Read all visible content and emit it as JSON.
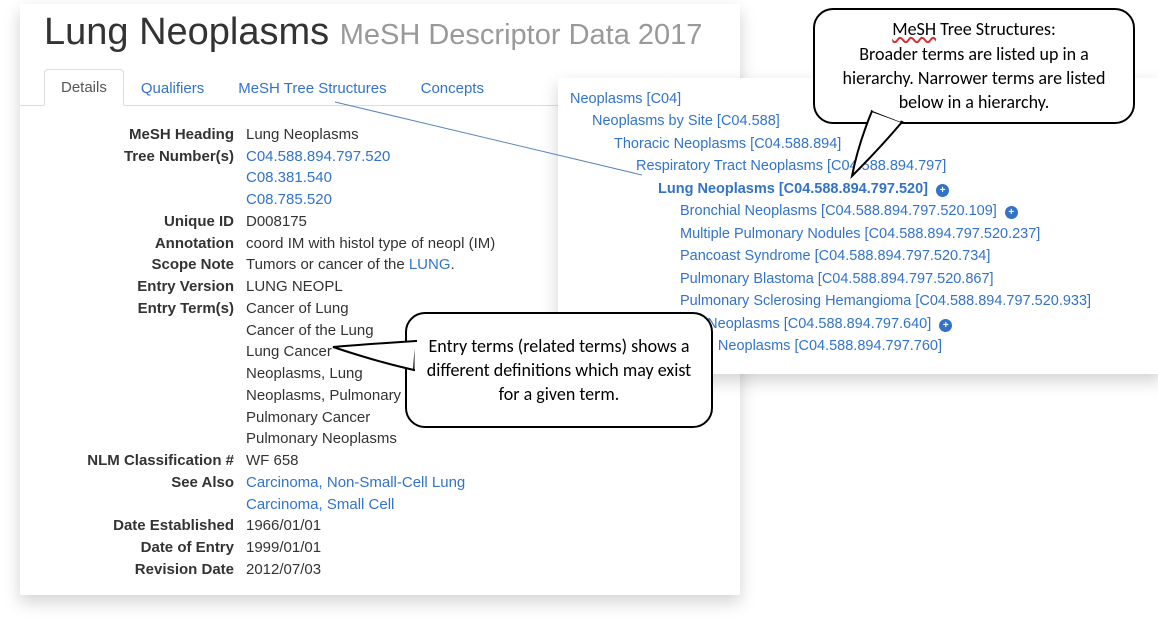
{
  "header": {
    "title": "Lung Neoplasms",
    "subtitle": "MeSH Descriptor Data 2017"
  },
  "tabs": {
    "items": [
      {
        "label": "Details",
        "active": true
      },
      {
        "label": "Qualifiers",
        "active": false
      },
      {
        "label": "MeSH Tree Structures",
        "active": false
      },
      {
        "label": "Concepts",
        "active": false
      }
    ]
  },
  "details": {
    "mesh_heading": {
      "label": "MeSH Heading",
      "value": "Lung Neoplasms"
    },
    "tree_numbers": {
      "label": "Tree Number(s)",
      "values": [
        "C04.588.894.797.520",
        "C08.381.540",
        "C08.785.520"
      ]
    },
    "unique_id": {
      "label": "Unique ID",
      "value": "D008175"
    },
    "annotation": {
      "label": "Annotation",
      "value": "coord IM with histol type of neopl (IM)"
    },
    "scope_note": {
      "label": "Scope Note",
      "prefix": "Tumors or cancer of the ",
      "link_text": "LUNG",
      "suffix": "."
    },
    "entry_version": {
      "label": "Entry Version",
      "value": "LUNG NEOPL"
    },
    "entry_terms": {
      "label": "Entry Term(s)",
      "values": [
        "Cancer of Lung",
        "Cancer of the Lung",
        "Lung Cancer",
        "Neoplasms, Lung",
        "Neoplasms, Pulmonary",
        "Pulmonary Cancer",
        "Pulmonary Neoplasms"
      ]
    },
    "nlm_class": {
      "label": "NLM Classification #",
      "value": "WF 658"
    },
    "see_also": {
      "label": "See Also",
      "values": [
        "Carcinoma, Non-Small-Cell Lung",
        "Carcinoma, Small Cell"
      ]
    },
    "date_established": {
      "label": "Date Established",
      "value": "1966/01/01"
    },
    "date_of_entry": {
      "label": "Date of Entry",
      "value": "1999/01/01"
    },
    "revision_date": {
      "label": "Revision Date",
      "value": "2012/07/03"
    }
  },
  "tree": {
    "nodes": [
      {
        "indent": 0,
        "text": "Neoplasms [C04]",
        "bold": false,
        "plus": false
      },
      {
        "indent": 1,
        "text": "Neoplasms by Site [C04.588]",
        "bold": false,
        "plus": false
      },
      {
        "indent": 2,
        "text": "Thoracic Neoplasms [C04.588.894]",
        "bold": false,
        "plus": false
      },
      {
        "indent": 3,
        "text": "Respiratory Tract Neoplasms [C04.588.894.797]",
        "bold": false,
        "plus": false
      },
      {
        "indent": 4,
        "text": "Lung Neoplasms [C04.588.894.797.520]",
        "bold": true,
        "plus": true
      },
      {
        "indent": 5,
        "text": "Bronchial Neoplasms [C04.588.894.797.520.109]",
        "bold": false,
        "plus": true
      },
      {
        "indent": 5,
        "text": "Multiple Pulmonary Nodules [C04.588.894.797.520.237]",
        "bold": false,
        "plus": false
      },
      {
        "indent": 5,
        "text": "Pancoast Syndrome [C04.588.894.797.520.734]",
        "bold": false,
        "plus": false
      },
      {
        "indent": 5,
        "text": "Pulmonary Blastoma [C04.588.894.797.520.867]",
        "bold": false,
        "plus": false
      },
      {
        "indent": 5,
        "text": "Pulmonary Sclerosing Hemangioma [C04.588.894.797.520.933]",
        "bold": false,
        "plus": false
      },
      {
        "indent": 4,
        "text": "Pleural Neoplasms [C04.588.894.797.640]",
        "bold": false,
        "plus": true
      },
      {
        "indent": 4,
        "text": "Tracheal Neoplasms [C04.588.894.797.760]",
        "bold": false,
        "plus": false
      }
    ]
  },
  "callouts": {
    "tree_structures": {
      "line1_prefix": "",
      "line1_u": "MeSH",
      "line1_suffix": " Tree Structures:",
      "rest": "Broader terms are listed up in a hierarchy. Narrower terms are listed below in a hierarchy."
    },
    "entry_terms": {
      "text": "Entry terms (related terms) shows a different definitions which may exist for a given term."
    }
  }
}
